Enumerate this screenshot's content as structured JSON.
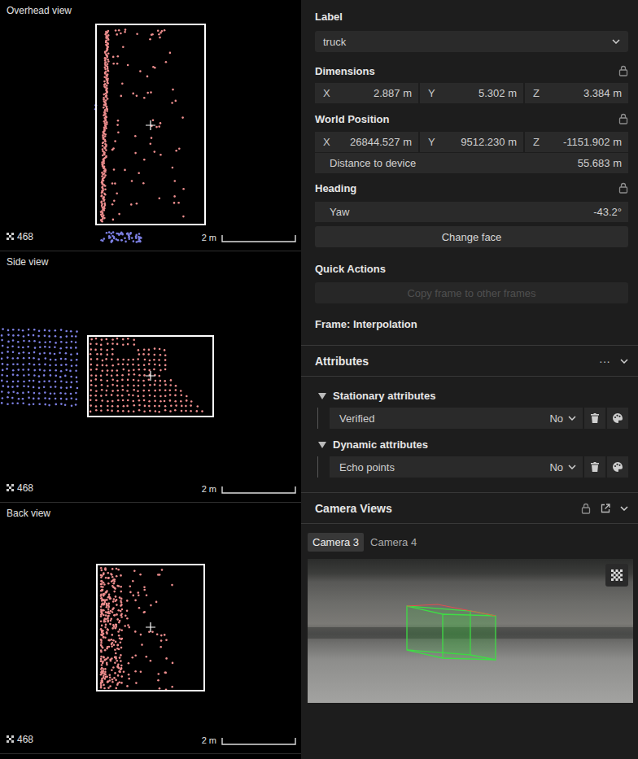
{
  "views": [
    {
      "title": "Overhead view",
      "count": "468",
      "scale": "2 m"
    },
    {
      "title": "Side view",
      "count": "468",
      "scale": "2 m"
    },
    {
      "title": "Back view",
      "count": "468",
      "scale": "2 m"
    }
  ],
  "label": {
    "heading": "Label",
    "value": "truck"
  },
  "dimensions": {
    "heading": "Dimensions",
    "locked": true,
    "fields": [
      {
        "axis": "X",
        "value": "2.887 m"
      },
      {
        "axis": "Y",
        "value": "5.302 m"
      },
      {
        "axis": "Z",
        "value": "3.384 m"
      }
    ]
  },
  "world_position": {
    "heading": "World Position",
    "locked": true,
    "fields": [
      {
        "axis": "X",
        "value": "26844.527 m"
      },
      {
        "axis": "Y",
        "value": "9512.230 m"
      },
      {
        "axis": "Z",
        "value": "-1151.902 m"
      }
    ],
    "distance": {
      "label": "Distance to device",
      "value": "55.683 m"
    }
  },
  "heading": {
    "heading": "Heading",
    "locked": true,
    "yaw": {
      "label": "Yaw",
      "value": "-43.2°"
    },
    "button": "Change face"
  },
  "quick_actions": {
    "heading": "Quick Actions",
    "button": {
      "label": "Copy frame to other frames",
      "disabled": true
    }
  },
  "frame": "Frame: Interpolation",
  "attributes": {
    "heading": "Attributes",
    "menu": "···",
    "groups": [
      {
        "title": "Stationary attributes",
        "expanded": true,
        "rows": [
          {
            "name": "Verified",
            "value": "No"
          }
        ]
      },
      {
        "title": "Dynamic attributes",
        "expanded": true,
        "rows": [
          {
            "name": "Echo points",
            "value": "No"
          }
        ]
      }
    ]
  },
  "camera_views": {
    "heading": "Camera Views",
    "tabs": [
      {
        "label": "Camera 3",
        "selected": true
      },
      {
        "label": "Camera 4",
        "selected": false
      }
    ]
  }
}
